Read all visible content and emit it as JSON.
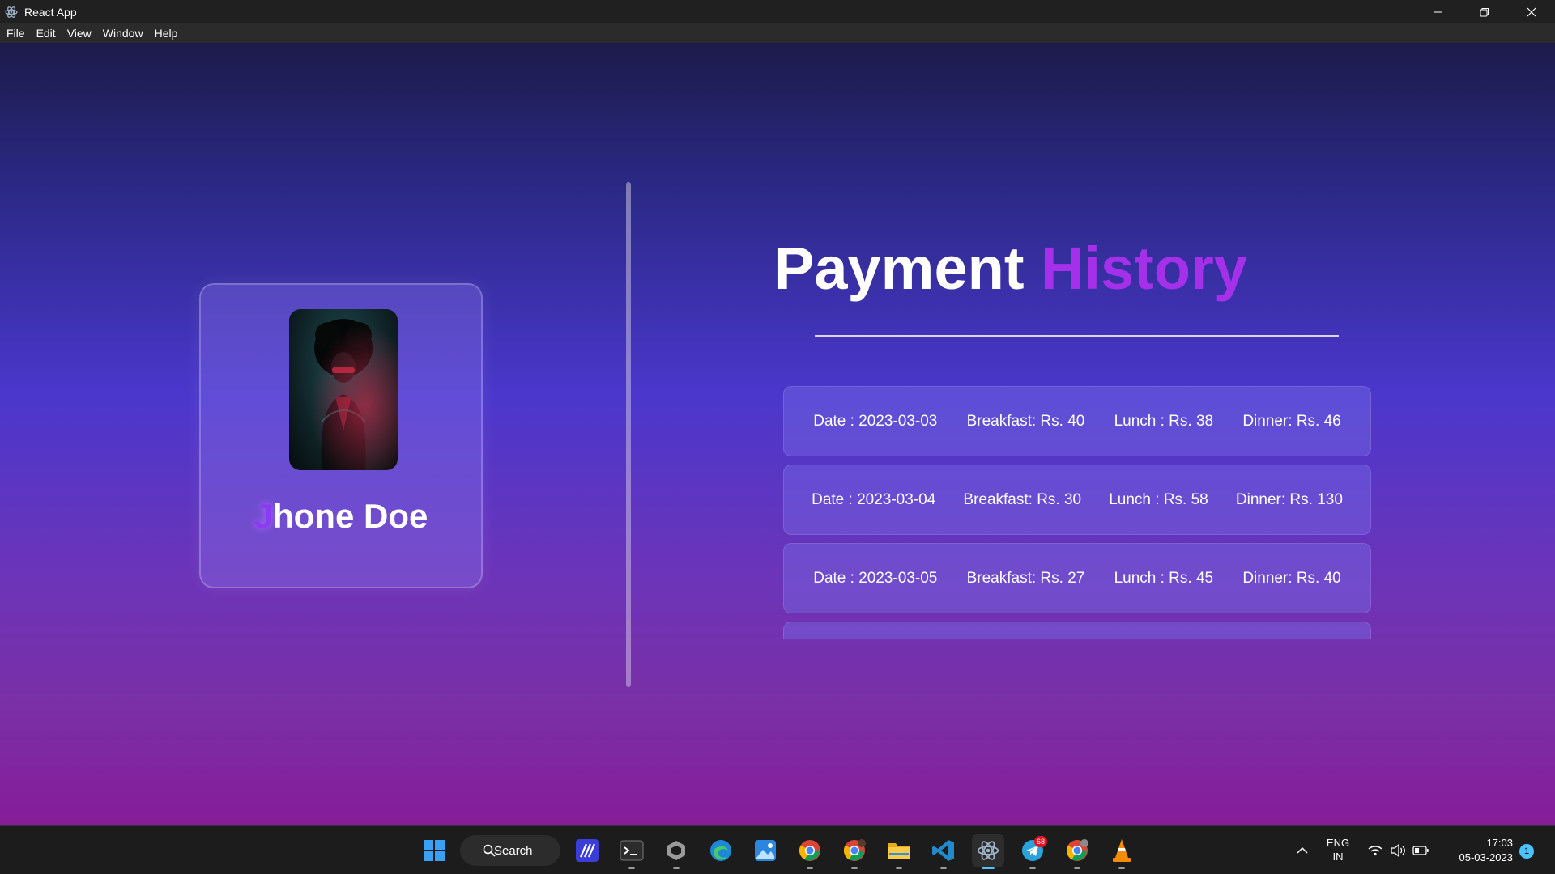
{
  "window": {
    "title": "React App",
    "menu": [
      "File",
      "Edit",
      "View",
      "Window",
      "Help"
    ]
  },
  "profile": {
    "name_first_letter": "J",
    "name_rest": "hone Doe"
  },
  "history": {
    "title_main": "Payment",
    "title_accent": "History",
    "rows": [
      {
        "date": "Date : 2023-03-03",
        "breakfast": "Breakfast: Rs. 40",
        "lunch": "Lunch : Rs. 38",
        "dinner": "Dinner: Rs. 46"
      },
      {
        "date": "Date : 2023-03-04",
        "breakfast": "Breakfast: Rs. 30",
        "lunch": "Lunch : Rs. 58",
        "dinner": "Dinner: Rs. 130"
      },
      {
        "date": "Date : 2023-03-05",
        "breakfast": "Breakfast: Rs. 27",
        "lunch": "Lunch : Rs. 45",
        "dinner": "Dinner: Rs. 40"
      }
    ]
  },
  "taskbar": {
    "search_label": "Search",
    "telegram_badge": "68",
    "lang_line1": "ENG",
    "lang_line2": "IN",
    "time": "17:03",
    "date": "05-03-2023",
    "notification_count": "1"
  },
  "colors": {
    "accent_purple": "#a431e9",
    "taskbar_active": "#4cc2ff"
  }
}
